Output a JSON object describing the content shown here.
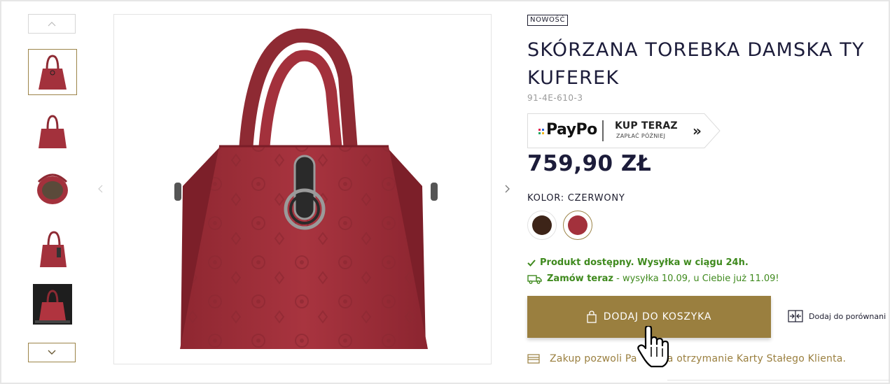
{
  "badge": "NOWOŚĆ",
  "title_line1": "SKÓRZANA TOREBKA DAMSKA TY",
  "title_line2": "KUFEREK",
  "sku": "91-4E-610-3",
  "paypo": {
    "logo": "PayPo",
    "kup_teraz": "KUP TERAZ",
    "zaplac_pozniej": "ZAPŁAĆ PÓŹNIEJ",
    "arrow": "»"
  },
  "price": "759,90 ZŁ",
  "color_label": "KOLOR: CZERWONY",
  "swatches": [
    {
      "name": "brązowy",
      "color": "#3d2418"
    },
    {
      "name": "czerwony",
      "color": "#a3313c"
    }
  ],
  "availability": "Produkt dostępny. Wysyłka w ciągu 24h.",
  "shipping": {
    "prefix": "Zamów teraz",
    "rest": " - wysyłka 10.09, u Ciebie już 11.09!"
  },
  "add_to_cart": "DODAJ DO KOSZYKA",
  "compare": "Dodaj do porównani",
  "loyalty_before": "Zakup pozwoli Pa",
  "loyalty_after": "na otrzymanie Karty Stałego Klienta.",
  "icons": {
    "thumb_up": "chevron-up-icon",
    "thumb_down": "chevron-down-icon",
    "gallery_prev": "chevron-left-icon",
    "gallery_next": "chevron-right-icon",
    "check": "check-icon",
    "truck": "truck-icon",
    "bag": "shopping-bag-icon",
    "compare": "compare-icon",
    "card": "card-icon",
    "cursor": "hand-pointer-icon"
  },
  "colors": {
    "accent": "#9a7f3f",
    "success": "#3f8a1e",
    "text": "#1c1c3a",
    "bag": "#a3313c"
  }
}
